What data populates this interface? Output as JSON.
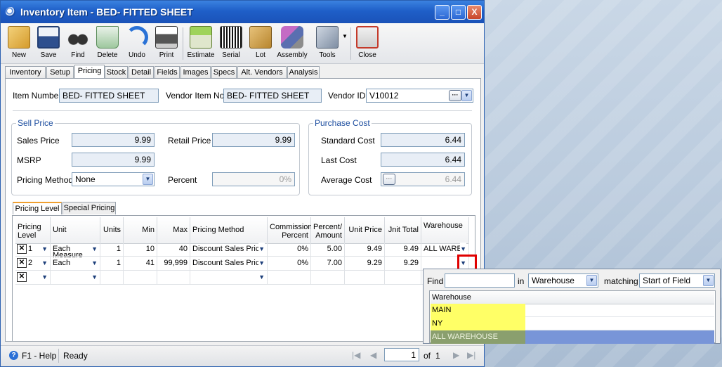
{
  "window": {
    "title": "Inventory Item - BED- FITTED SHEET"
  },
  "window_buttons": {
    "minimize": "_",
    "maximize": "□",
    "close": "X"
  },
  "toolbar": [
    {
      "label": "New",
      "icon": "new-item-icon"
    },
    {
      "label": "Save",
      "icon": "floppy-disk-icon"
    },
    {
      "label": "Find",
      "icon": "binoculars-icon"
    },
    {
      "label": "Delete",
      "icon": "recycle-bin-icon"
    },
    {
      "label": "Undo",
      "icon": "undo-arrow-icon"
    },
    {
      "label": "Print",
      "icon": "printer-icon"
    },
    {
      "label": "Estimate",
      "icon": "calculator-icon"
    },
    {
      "label": "Serial",
      "icon": "barcode-icon"
    },
    {
      "label": "Lot",
      "icon": "boxes-icon"
    },
    {
      "label": "Assembly",
      "icon": "assembly-icon"
    },
    {
      "label": "Tools",
      "icon": "tools-icon"
    },
    {
      "label": "Close",
      "icon": "close-door-icon"
    }
  ],
  "tabs": [
    "Inventory",
    "Setup",
    "Pricing",
    "Stock",
    "Detail",
    "Fields",
    "Images",
    "Specs",
    "Alt. Vendors",
    "Analysis"
  ],
  "active_tab": "Pricing",
  "header": {
    "item_number_label": "Item Number",
    "item_number": "BED- FITTED SHEET",
    "vendor_item_label": "Vendor Item No",
    "vendor_item": "BED- FITTED SHEET",
    "vendor_id_label": "Vendor ID",
    "vendor_id": "V10012"
  },
  "sell_price": {
    "title": "Sell Price",
    "sales_price_label": "Sales Price",
    "sales_price": "9.99",
    "retail_price_label": "Retail Price",
    "retail_price": "9.99",
    "msrp_label": "MSRP",
    "msrp": "9.99",
    "pricing_method_label": "Pricing Method",
    "pricing_method": "None",
    "percent_label": "Percent",
    "percent": "0%"
  },
  "purchase_cost": {
    "title": "Purchase Cost",
    "standard_cost_label": "Standard Cost",
    "standard_cost": "6.44",
    "last_cost_label": "Last Cost",
    "last_cost": "6.44",
    "average_cost_label": "Average Cost",
    "average_cost": "6.44"
  },
  "subtabs": [
    "Pricing Level",
    "Special Pricing"
  ],
  "grid": {
    "headers": {
      "level": [
        "Pricing",
        "Level"
      ],
      "unit_measure": "Unit Measure",
      "units": "Units",
      "min": "Min",
      "max": "Max",
      "pricing_method": "Pricing Method",
      "commission": [
        "Commission",
        "Percent"
      ],
      "percent_amount": [
        "Percent/",
        "Amount"
      ],
      "unit_price": "Unit Price",
      "unit_total": "Jnit Total",
      "warehouse": "Warehouse"
    },
    "rows": [
      {
        "level": "1",
        "unit": "Each",
        "units": "1",
        "min": "10",
        "max": "40",
        "method": "Discount Sales Pric",
        "commission": "0%",
        "pct_amt": "5.00",
        "unit_price": "9.49",
        "unit_total": "9.49",
        "warehouse": "ALL WARE"
      },
      {
        "level": "2",
        "unit": "Each",
        "units": "1",
        "min": "41",
        "max": "99,999",
        "method": "Discount Sales Pric",
        "commission": "0%",
        "pct_amt": "7.00",
        "unit_price": "9.29",
        "unit_total": "9.29",
        "warehouse": ""
      }
    ]
  },
  "lookup": {
    "find_label": "Find",
    "find_value": "",
    "in_label": "in",
    "in_field": "Warehouse",
    "matching_label": "matching",
    "matching_mode": "Start of Field",
    "column_header": "Warehouse",
    "items": [
      "MAIN",
      "NY",
      "ALL WAREHOUSE"
    ],
    "selected_index": 2
  },
  "status": {
    "help": "F1 - Help",
    "state": "Ready",
    "page": "1",
    "of_label": "of",
    "total_pages": "1"
  },
  "colors": {
    "title_bar": "#1f5fc8",
    "highlight": "#ffff66",
    "selected_row": "#7895d8",
    "callout": "#e00000"
  }
}
